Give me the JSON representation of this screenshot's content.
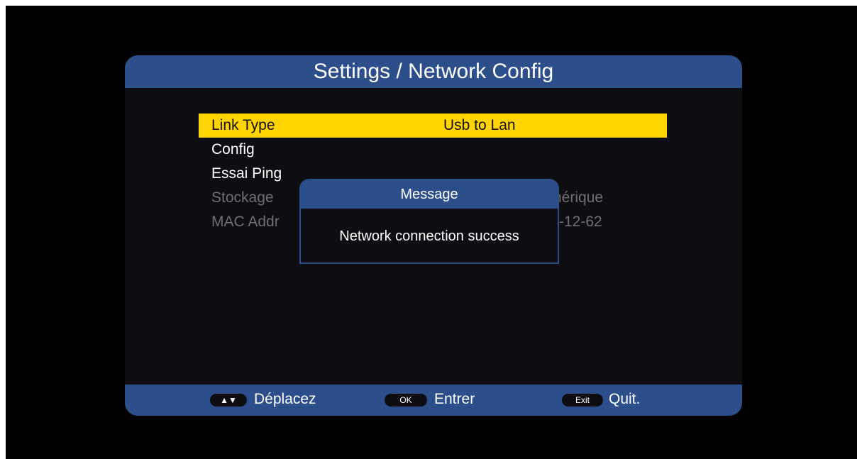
{
  "header": {
    "title": "Settings / Network Config"
  },
  "menu": [
    {
      "label": "Link Type",
      "value": "Usb to Lan"
    },
    {
      "label": "Config",
      "value": ""
    },
    {
      "label": "Essai Ping",
      "value": ""
    },
    {
      "label": "Stockage",
      "value": "hérique"
    },
    {
      "label": "MAC Addr",
      "value": "-12-62"
    }
  ],
  "dialog": {
    "title": "Message",
    "message": "Network connection success"
  },
  "footer": {
    "move": {
      "key": "▲▼",
      "label": "Déplacez"
    },
    "ok": {
      "key": "OK",
      "label": "Entrer"
    },
    "exit": {
      "key": "Exit",
      "label": "Quit."
    }
  },
  "colors": {
    "accent": "#2c4f8c",
    "highlight": "#ffd400",
    "background": "#0d0d12"
  }
}
